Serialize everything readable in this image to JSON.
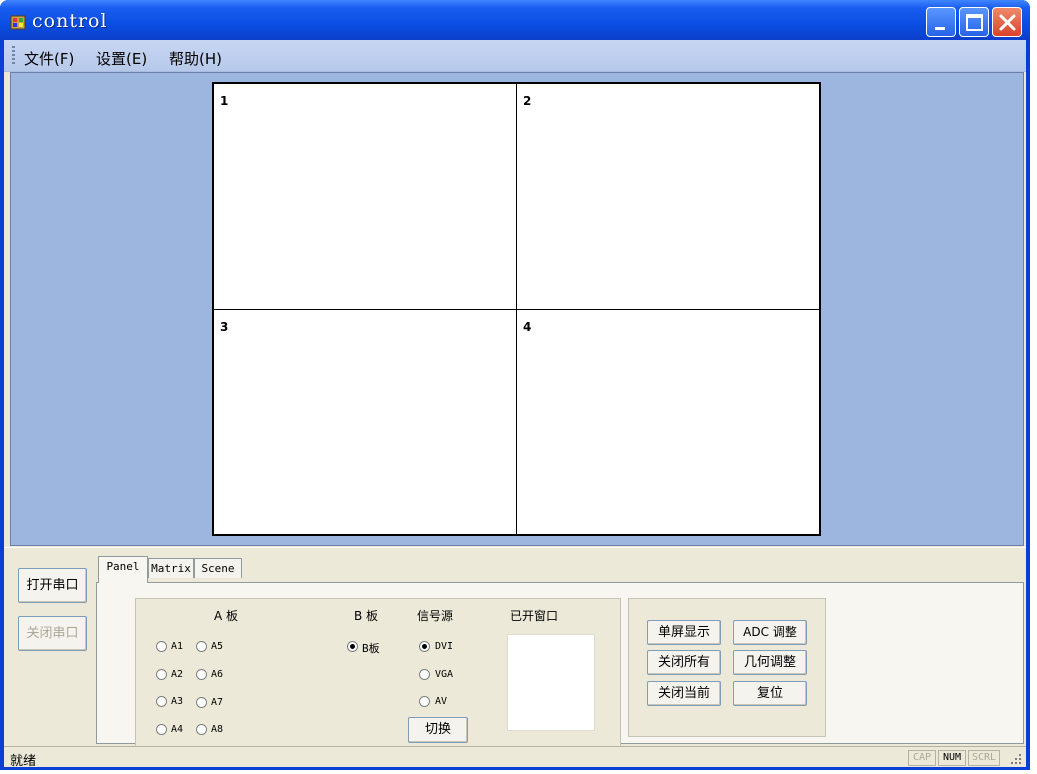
{
  "window": {
    "title": "control"
  },
  "menu": {
    "file": "文件(F)",
    "settings": "设置(E)",
    "help": "帮助(H)"
  },
  "grid": {
    "cells": [
      "1",
      "2",
      "3",
      "4"
    ]
  },
  "serial": {
    "open": "打开串口",
    "close": "关闭串口"
  },
  "tabs": [
    "Panel",
    "Matrix",
    "Scene"
  ],
  "panel": {
    "a_board_label": "A 板",
    "b_board_label": "B 板",
    "signal_label": "信号源",
    "opened_windows_label": "已开窗口",
    "a_options": [
      "A1",
      "A5",
      "A2",
      "A6",
      "A3",
      "A7",
      "A4",
      "A8"
    ],
    "b_option": "B板",
    "signal_options": [
      "DVI",
      "VGA",
      "AV"
    ],
    "signal_selected": "DVI",
    "switch_button": "切换"
  },
  "actions": {
    "single_display": "单屏显示",
    "adc_adjust": "ADC 调整",
    "close_all": "关闭所有",
    "geometry_adjust": "几何调整",
    "close_current": "关闭当前",
    "reset": "复位"
  },
  "status": {
    "text": "就绪",
    "cap": "CAP",
    "num": "NUM",
    "scrl": "SCRL"
  },
  "colors": {
    "title_bar": "#0a4ee3",
    "display_bg": "#9db6e0",
    "dialog_bg": "#ece9d8",
    "close_button": "#d9432a"
  }
}
